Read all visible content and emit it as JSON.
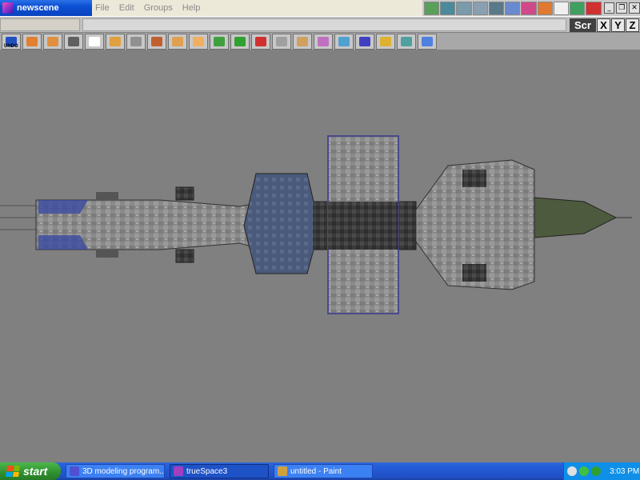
{
  "window": {
    "title": "newscene"
  },
  "menu": {
    "items": [
      "File",
      "Edit",
      "Groups",
      "Help"
    ]
  },
  "view_buttons": [
    {
      "icon": "perspective-view-icon",
      "color": "#5aa05a"
    },
    {
      "icon": "top-view-icon",
      "color": "#4a8a9a"
    },
    {
      "icon": "front-view-icon",
      "color": "#7a9aaa"
    },
    {
      "icon": "left-view-icon",
      "color": "#8aa0b0"
    },
    {
      "icon": "camera-view-icon",
      "color": "#5a7a8a"
    },
    {
      "icon": "render-grid-icon",
      "color": "#6a8ad0"
    },
    {
      "icon": "material-icon",
      "color": "#d04a8a"
    },
    {
      "icon": "render-icon",
      "color": "#e07a30"
    },
    {
      "icon": "window-icon",
      "color": "#f0f0f0"
    },
    {
      "icon": "panel-icon",
      "color": "#40a060"
    },
    {
      "icon": "help-icon",
      "color": "#d03030"
    }
  ],
  "axis": {
    "scr": "Scr",
    "x": "X",
    "y": "Y",
    "z": "Z"
  },
  "toolbar": {
    "undo_label": "UNDO",
    "tools": [
      {
        "icon": "undo-icon",
        "color": "#2050c0"
      },
      {
        "icon": "object-tool-icon",
        "color": "#e08030"
      },
      {
        "icon": "cube-icon",
        "color": "#e09040"
      },
      {
        "icon": "eye-move-icon",
        "color": "#606060"
      },
      {
        "icon": "pointer-icon",
        "color": "#ffffff"
      },
      {
        "icon": "rotate-icon",
        "color": "#e0a040"
      },
      {
        "icon": "home-icon",
        "color": "#909090"
      },
      {
        "icon": "box-icon",
        "color": "#c06030"
      },
      {
        "icon": "primitive-icon",
        "color": "#e0a050"
      },
      {
        "icon": "sphere-icon",
        "color": "#f0b060"
      },
      {
        "icon": "boolean-icon",
        "color": "#40a040"
      },
      {
        "icon": "deform-icon",
        "color": "#30a030"
      },
      {
        "icon": "light-icon",
        "color": "#d03030"
      },
      {
        "icon": "path-icon",
        "color": "#a0a0a0"
      },
      {
        "icon": "paint-icon",
        "color": "#d0a060"
      },
      {
        "icon": "brush-icon",
        "color": "#c070c0"
      },
      {
        "icon": "material-balls-icon",
        "color": "#50a0d0"
      },
      {
        "icon": "grid-icon",
        "color": "#4040c0"
      },
      {
        "icon": "animation-icon",
        "color": "#e0b030"
      },
      {
        "icon": "terrain-icon",
        "color": "#50a0a0"
      },
      {
        "icon": "3d-icon",
        "color": "#5080e0"
      }
    ]
  },
  "taskbar": {
    "start_label": "start",
    "tasks": [
      {
        "label": "3D modeling program...",
        "icon_color": "#5050d0",
        "active": false
      },
      {
        "label": "trueSpace3",
        "icon_color": "#a040c0",
        "active": true
      },
      {
        "label": "untitled - Paint",
        "icon_color": "#d0a040",
        "active": false
      }
    ],
    "clock": "3:03 PM"
  }
}
